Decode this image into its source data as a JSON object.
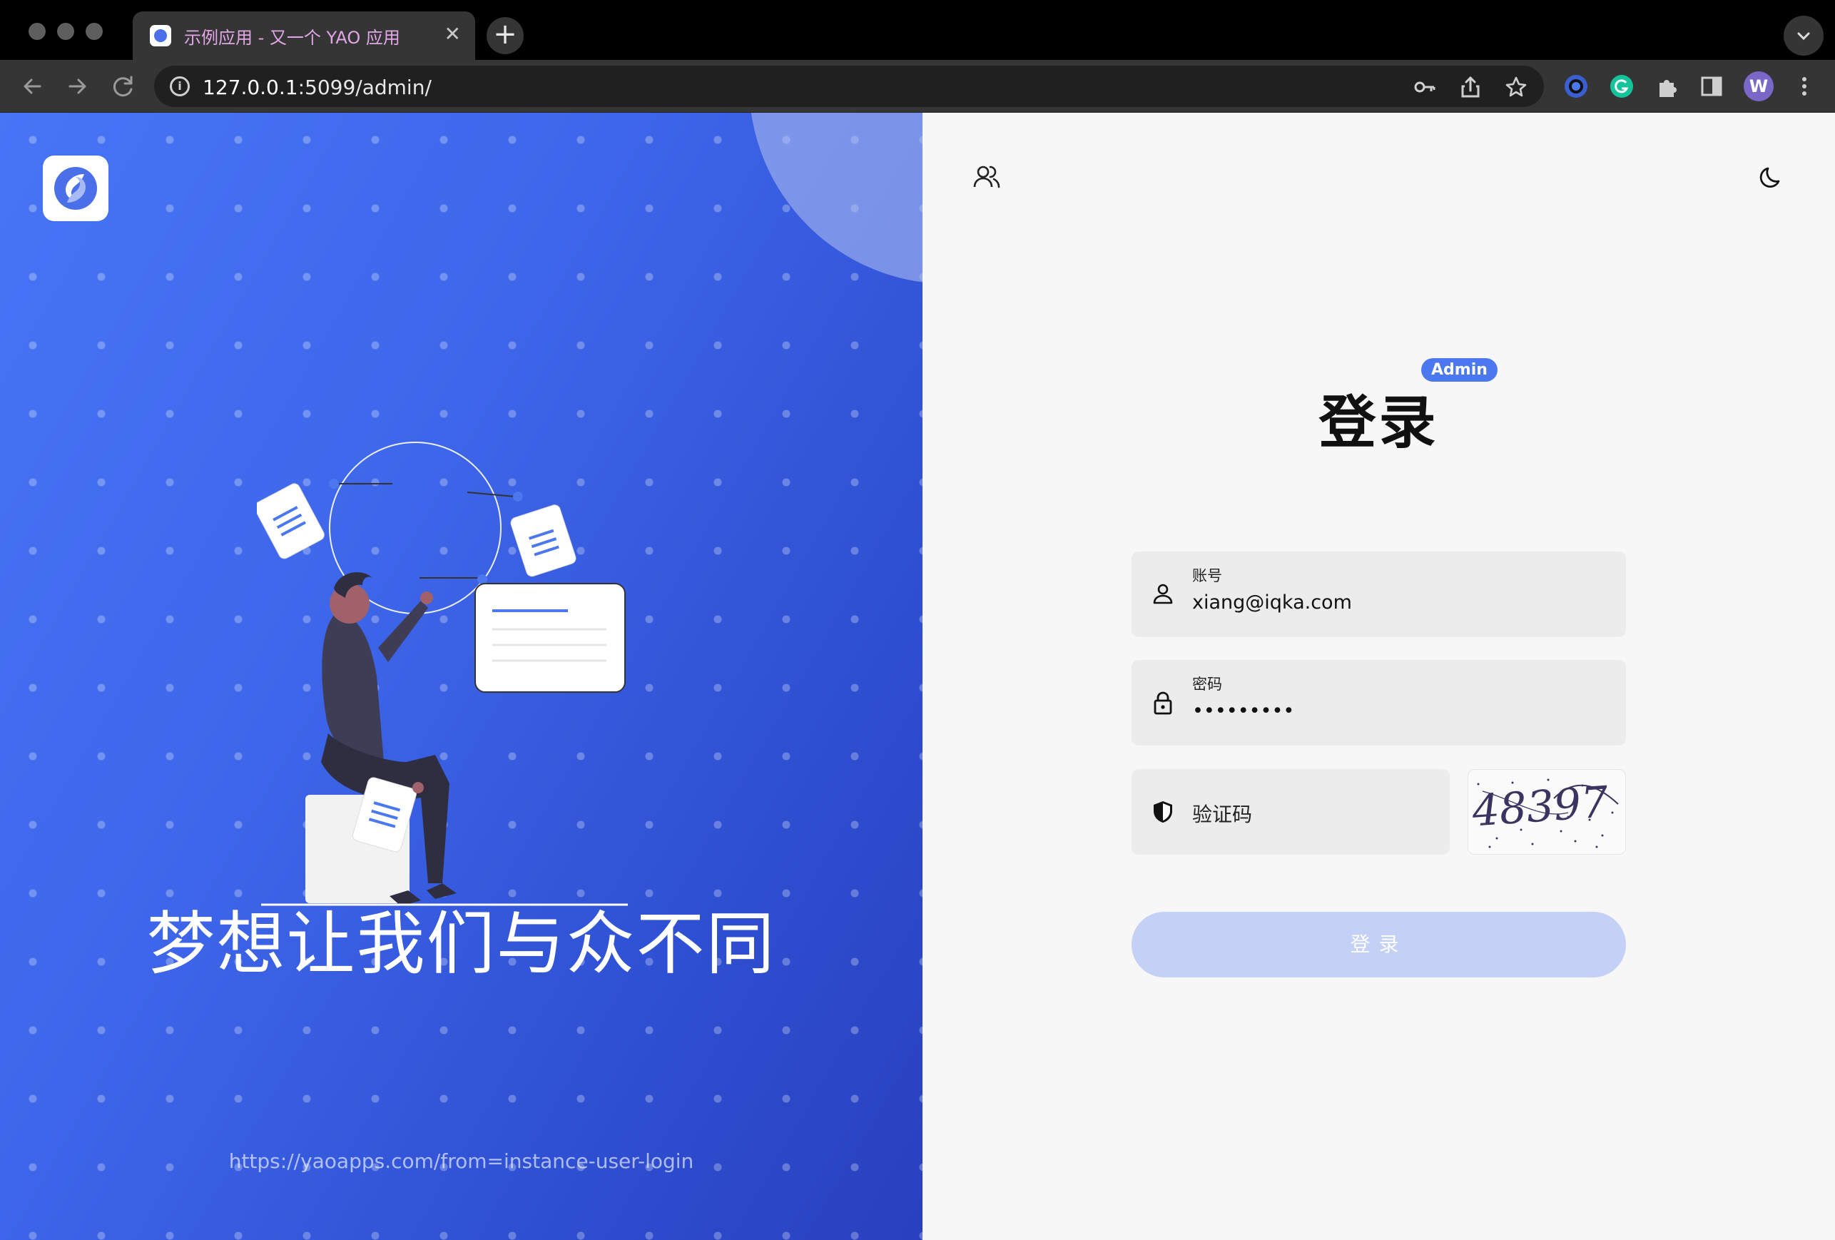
{
  "browser": {
    "tab_title": "示例应用 - 又一个 YAO 应用",
    "tab_close": "✕",
    "new_tab": "+",
    "url_host": "127.0.0.1",
    "url_rest": ":5099/admin/",
    "profile_initial": "W"
  },
  "left": {
    "slogan": "梦想让我们与众不同",
    "footer_link": "https://yaoapps.com/from=instance-user-login"
  },
  "login": {
    "title": "登录",
    "badge": "Admin",
    "account_label": "账号",
    "account_value": "xiang@iqka.com",
    "password_label": "密码",
    "password_value": "•••••••••",
    "captcha_placeholder": "验证码",
    "captcha_text": "48397",
    "submit_label": "登录"
  },
  "colors": {
    "accent": "#4b78ee",
    "left_gradient_start": "#4775f6",
    "left_gradient_end": "#2940bf",
    "button_disabled": "#c4d0f6"
  },
  "icons": [
    "key-icon",
    "share-icon",
    "star-icon",
    "extensions-icon",
    "sidepanel-icon",
    "user-switch-icon",
    "moon-icon",
    "user-icon",
    "lock-icon",
    "shield-icon"
  ]
}
